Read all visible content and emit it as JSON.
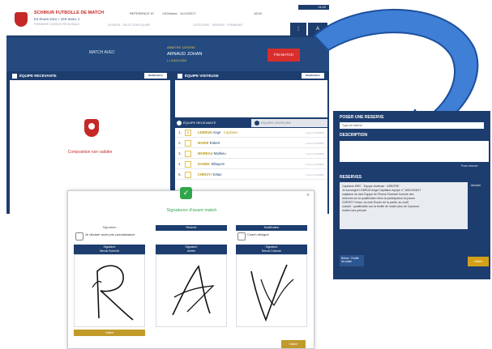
{
  "topbar": {
    "app_title": "SCHIRUR FUTBOLLE DE MATCH",
    "app_sub": "ES RIVAS 2010 + 1ER NIVEL 3",
    "app_sub2": "PREMIERE DIVISION REGIONALE",
    "match_ref_label": "REFERENCE N°",
    "match_ref_value": "VIGNobas · 11/10/2017",
    "match_time": "18:00",
    "info2": "DIVISION · SÉLECTION ÉQUIPE",
    "info3": "CATÉGORIE · SENIORS · FÉMININES",
    "status_time": "11:22",
    "nav_a": "⋮",
    "nav_b": "A"
  },
  "match": {
    "label": "MATCH AVEC",
    "referee_role": "ARBITRE CENTRE",
    "referee_name": "ARNAUD JOHAN",
    "referee_sub": "L.I.A.BOLDOMI",
    "action_button": "FIN MATCH"
  },
  "home": {
    "header": "ÉQUIPE RECEVANTE",
    "button": "Modification",
    "message": "Composition non validée"
  },
  "away": {
    "header": "ÉQUIPE VISITEUSE",
    "button": "Modification"
  },
  "tabs": [
    {
      "label": "ÉQUIPE RECEVANTE"
    },
    {
      "label": "ÉQUIPE VISITEUSE"
    }
  ],
  "players": [
    {
      "num": "1.",
      "box": "C",
      "first": "LEBRUN",
      "last": "Ange",
      "extra": "· Capitaine",
      "meta": "Licence 2546890"
    },
    {
      "num": "2.",
      "box": "",
      "first": "MARIE",
      "last": "Robert",
      "extra": "",
      "meta": "Licence 2546891"
    },
    {
      "num": "3.",
      "box": "",
      "first": "MOREAU",
      "last": "Mathieu",
      "extra": "",
      "meta": "Licence 2546892"
    },
    {
      "num": "4.",
      "box": "",
      "first": "DANIEL",
      "last": "Elbayem",
      "extra": "",
      "meta": "Licence 2546893"
    },
    {
      "num": "5.",
      "box": "",
      "first": "CHRISTI",
      "last": "Yohan",
      "extra": "",
      "meta": "Licence 2546894"
    }
  ],
  "reserve": {
    "title": "POSER UNE RÉSERVE",
    "type": "Type de réserve",
    "desc_title": "DESCRIPTION",
    "desc_button": "Pose réserve",
    "reserves_title": "RÉSERVES",
    "lines": [
      "Capitaine MRC · Équipe visiteuse · ARBITRE",
      "Je soussigné LEBRUN Ange Capitaine équipe n° 16510005/17",
      "capitaine du club Equipe de Pinens Floressé formule des",
      "réserves sur la qualification et/ou la participation du joueur",
      "CHRISTI Yohan, du club Rouen de la partie, au motif",
      "suivant : qualification sur la feuille de match plus de 3 joueurs",
      "mutés hors période"
    ],
    "delete_button": "Annuler",
    "footer_label": "Retour · Feuille de match",
    "add_button": "Valider"
  },
  "signature": {
    "title": "Signatures d'avant match",
    "close": "×",
    "columns": [
      {
        "top_label": "Signature",
        "check_text": "Je déclare avoir pris connaissance",
        "sig_label": "Signature",
        "sig_name": "Benoit Schmidt"
      },
      {
        "top_label": "Reserve",
        "check_text": "",
        "sig_label": "Signature",
        "sig_name": "Arbitre"
      },
      {
        "top_label": "Modification",
        "check_text": "Coach désigné",
        "sig_label": "Signature",
        "sig_name": "Benoit Collomb"
      }
    ],
    "foot_button": "Valider",
    "validate_button": "Valider"
  },
  "colors": {
    "navy": "#1d3d6e",
    "red": "#d92e2e",
    "gold": "#c19a2a",
    "green": "#2fa64a"
  }
}
